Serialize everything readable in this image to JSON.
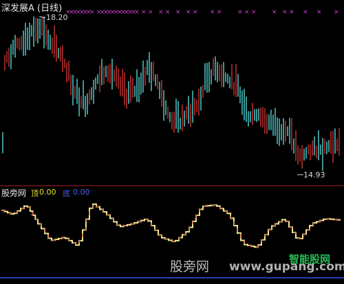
{
  "chart_header": {
    "title": "深发展A (日线)"
  },
  "price_panel": {
    "high_label": "18.20",
    "low_label": "14.93",
    "marker_color": "#d040d0",
    "up_color": "#c03030",
    "down_color": "#50c8c8"
  },
  "indicator_panel": {
    "name": "股旁网",
    "top_label": "顶",
    "top_value": "0.00",
    "bottom_label": "底",
    "bottom_value": "0.00",
    "top_color": "#e8e830",
    "bottom_color": "#4060ff",
    "step_colors": [
      "#f0e890",
      "#c03030"
    ]
  },
  "watermark": {
    "text": "股旁网",
    "url": "www.gupang.com",
    "site": "智能股网"
  }
}
